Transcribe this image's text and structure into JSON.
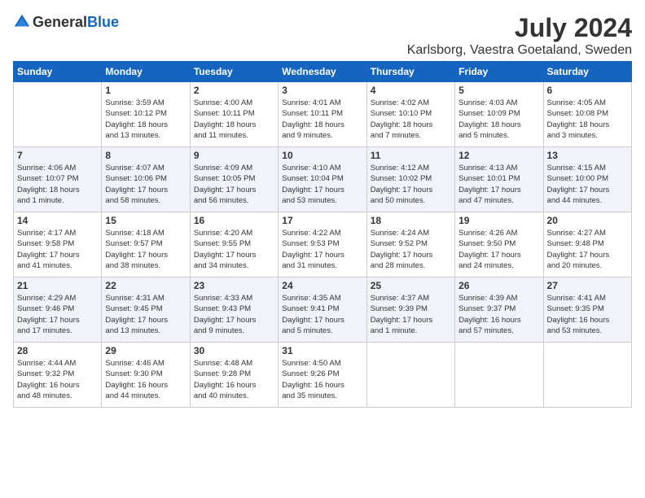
{
  "header": {
    "logo_general": "General",
    "logo_blue": "Blue",
    "month_title": "July 2024",
    "location": "Karlsborg, Vaestra Goetaland, Sweden"
  },
  "columns": [
    "Sunday",
    "Monday",
    "Tuesday",
    "Wednesday",
    "Thursday",
    "Friday",
    "Saturday"
  ],
  "weeks": [
    [
      {
        "day": "",
        "info": ""
      },
      {
        "day": "1",
        "info": "Sunrise: 3:59 AM\nSunset: 10:12 PM\nDaylight: 18 hours\nand 13 minutes."
      },
      {
        "day": "2",
        "info": "Sunrise: 4:00 AM\nSunset: 10:11 PM\nDaylight: 18 hours\nand 11 minutes."
      },
      {
        "day": "3",
        "info": "Sunrise: 4:01 AM\nSunset: 10:11 PM\nDaylight: 18 hours\nand 9 minutes."
      },
      {
        "day": "4",
        "info": "Sunrise: 4:02 AM\nSunset: 10:10 PM\nDaylight: 18 hours\nand 7 minutes."
      },
      {
        "day": "5",
        "info": "Sunrise: 4:03 AM\nSunset: 10:09 PM\nDaylight: 18 hours\nand 5 minutes."
      },
      {
        "day": "6",
        "info": "Sunrise: 4:05 AM\nSunset: 10:08 PM\nDaylight: 18 hours\nand 3 minutes."
      }
    ],
    [
      {
        "day": "7",
        "info": "Sunrise: 4:06 AM\nSunset: 10:07 PM\nDaylight: 18 hours\nand 1 minute."
      },
      {
        "day": "8",
        "info": "Sunrise: 4:07 AM\nSunset: 10:06 PM\nDaylight: 17 hours\nand 58 minutes."
      },
      {
        "day": "9",
        "info": "Sunrise: 4:09 AM\nSunset: 10:05 PM\nDaylight: 17 hours\nand 56 minutes."
      },
      {
        "day": "10",
        "info": "Sunrise: 4:10 AM\nSunset: 10:04 PM\nDaylight: 17 hours\nand 53 minutes."
      },
      {
        "day": "11",
        "info": "Sunrise: 4:12 AM\nSunset: 10:02 PM\nDaylight: 17 hours\nand 50 minutes."
      },
      {
        "day": "12",
        "info": "Sunrise: 4:13 AM\nSunset: 10:01 PM\nDaylight: 17 hours\nand 47 minutes."
      },
      {
        "day": "13",
        "info": "Sunrise: 4:15 AM\nSunset: 10:00 PM\nDaylight: 17 hours\nand 44 minutes."
      }
    ],
    [
      {
        "day": "14",
        "info": "Sunrise: 4:17 AM\nSunset: 9:58 PM\nDaylight: 17 hours\nand 41 minutes."
      },
      {
        "day": "15",
        "info": "Sunrise: 4:18 AM\nSunset: 9:57 PM\nDaylight: 17 hours\nand 38 minutes."
      },
      {
        "day": "16",
        "info": "Sunrise: 4:20 AM\nSunset: 9:55 PM\nDaylight: 17 hours\nand 34 minutes."
      },
      {
        "day": "17",
        "info": "Sunrise: 4:22 AM\nSunset: 9:53 PM\nDaylight: 17 hours\nand 31 minutes."
      },
      {
        "day": "18",
        "info": "Sunrise: 4:24 AM\nSunset: 9:52 PM\nDaylight: 17 hours\nand 28 minutes."
      },
      {
        "day": "19",
        "info": "Sunrise: 4:26 AM\nSunset: 9:50 PM\nDaylight: 17 hours\nand 24 minutes."
      },
      {
        "day": "20",
        "info": "Sunrise: 4:27 AM\nSunset: 9:48 PM\nDaylight: 17 hours\nand 20 minutes."
      }
    ],
    [
      {
        "day": "21",
        "info": "Sunrise: 4:29 AM\nSunset: 9:46 PM\nDaylight: 17 hours\nand 17 minutes."
      },
      {
        "day": "22",
        "info": "Sunrise: 4:31 AM\nSunset: 9:45 PM\nDaylight: 17 hours\nand 13 minutes."
      },
      {
        "day": "23",
        "info": "Sunrise: 4:33 AM\nSunset: 9:43 PM\nDaylight: 17 hours\nand 9 minutes."
      },
      {
        "day": "24",
        "info": "Sunrise: 4:35 AM\nSunset: 9:41 PM\nDaylight: 17 hours\nand 5 minutes."
      },
      {
        "day": "25",
        "info": "Sunrise: 4:37 AM\nSunset: 9:39 PM\nDaylight: 17 hours\nand 1 minute."
      },
      {
        "day": "26",
        "info": "Sunrise: 4:39 AM\nSunset: 9:37 PM\nDaylight: 16 hours\nand 57 minutes."
      },
      {
        "day": "27",
        "info": "Sunrise: 4:41 AM\nSunset: 9:35 PM\nDaylight: 16 hours\nand 53 minutes."
      }
    ],
    [
      {
        "day": "28",
        "info": "Sunrise: 4:44 AM\nSunset: 9:32 PM\nDaylight: 16 hours\nand 48 minutes."
      },
      {
        "day": "29",
        "info": "Sunrise: 4:46 AM\nSunset: 9:30 PM\nDaylight: 16 hours\nand 44 minutes."
      },
      {
        "day": "30",
        "info": "Sunrise: 4:48 AM\nSunset: 9:28 PM\nDaylight: 16 hours\nand 40 minutes."
      },
      {
        "day": "31",
        "info": "Sunrise: 4:50 AM\nSunset: 9:26 PM\nDaylight: 16 hours\nand 35 minutes."
      },
      {
        "day": "",
        "info": ""
      },
      {
        "day": "",
        "info": ""
      },
      {
        "day": "",
        "info": ""
      }
    ]
  ]
}
